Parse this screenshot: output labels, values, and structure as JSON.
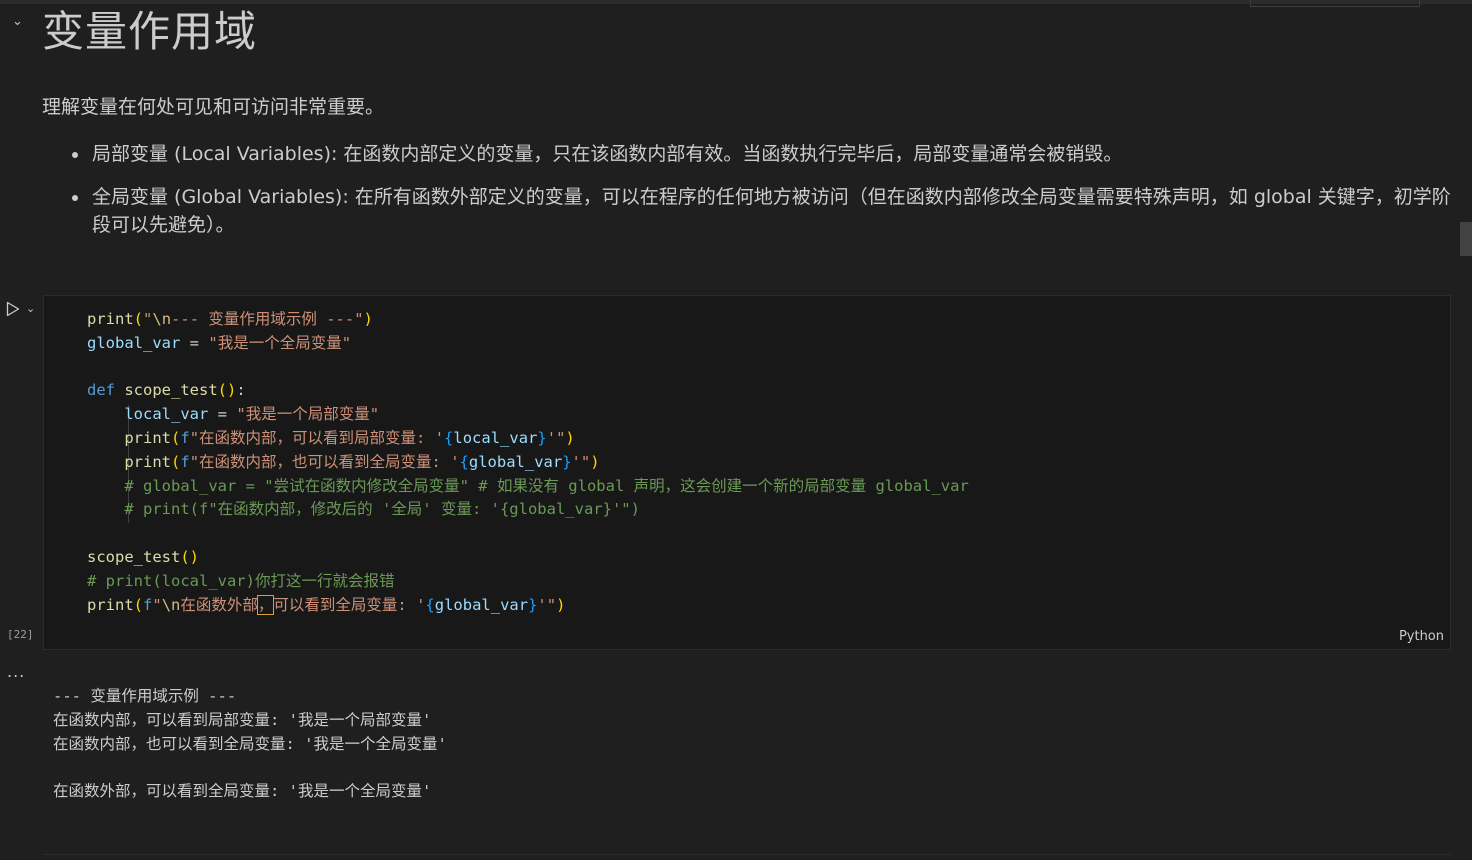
{
  "markdown": {
    "heading": "变量作用域",
    "intro": "理解变量在何处可见和可访问非常重要。",
    "bullets": [
      "局部变量 (Local Variables): 在函数内部定义的变量，只在该函数内部有效。当函数执行完毕后，局部变量通常会被销毁。",
      "全局变量 (Global Variables): 在所有函数外部定义的变量，可以在程序的任何地方被访问（但在函数内部修改全局变量需要特殊声明，如 global 关键字，初学阶段可以先避免）。"
    ]
  },
  "cell": {
    "execution_count": "[22]",
    "language": "Python",
    "code_lines": [
      "print(\"\\n--- 变量作用域示例 ---\")",
      "global_var = \"我是一个全局变量\"",
      "",
      "def scope_test():",
      "    local_var = \"我是一个局部变量\"",
      "    print(f\"在函数内部，可以看到局部变量: '{local_var}'\")",
      "    print(f\"在函数内部，也可以看到全局变量: '{global_var}'\")",
      "    # global_var = \"尝试在函数内修改全局变量\" # 如果没有 global 声明，这会创建一个新的局部变量 global_var",
      "    # print(f\"在函数内部，修改后的 '全局' 变量: '{global_var}'\")",
      "",
      "scope_test()",
      "# print(local_var)你打这一行就会报错",
      "print(f\"\\n在函数外部，可以看到全局变量: '{global_var}'\")"
    ]
  },
  "output": {
    "menu_label": "...",
    "lines": [
      "--- 变量作用域示例 ---",
      "在函数内部，可以看到局部变量: '我是一个局部变量'",
      "在函数内部，也可以看到全局变量: '我是一个全局变量'",
      "",
      "在函数外部，可以看到全局变量: '我是一个全局变量'"
    ]
  },
  "icons": {
    "collapse": "chevron-down-icon",
    "run": "run-play-icon",
    "run_menu": "chevron-down-icon"
  },
  "colors": {
    "background": "#1f1f1f",
    "editor_background": "#181818",
    "function": "#dcdcaa",
    "variable": "#9cdcfe",
    "keyword": "#569cd6",
    "string": "#ce9178",
    "comment": "#6a9955"
  }
}
